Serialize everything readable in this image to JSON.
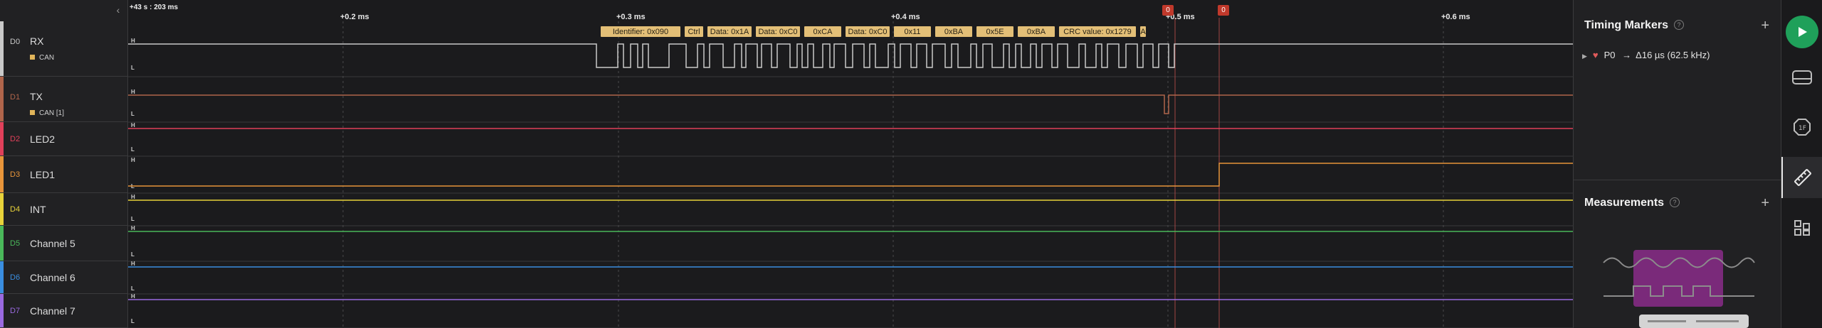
{
  "timeline": {
    "origin_label": "+43 s : 203 ms",
    "ticks": [
      "+0.2 ms",
      "+0.3 ms",
      "+0.4 ms",
      "+0.5 ms",
      "+0.6 ms"
    ]
  },
  "markers": {
    "flag_a": "0",
    "flag_b": "0"
  },
  "channels": [
    {
      "id": "D0",
      "name": "RX",
      "tag": "CAN",
      "color": "#c9c9c9"
    },
    {
      "id": "D1",
      "name": "TX",
      "tag": "CAN [1]",
      "color": "#b0654b"
    },
    {
      "id": "D2",
      "name": "LED2",
      "tag": "",
      "color": "#e0405a"
    },
    {
      "id": "D3",
      "name": "LED1",
      "tag": "",
      "color": "#e8953a"
    },
    {
      "id": "D4",
      "name": "INT",
      "tag": "",
      "color": "#e8d23a"
    },
    {
      "id": "D5",
      "name": "Channel 5",
      "tag": "",
      "color": "#4ab85a"
    },
    {
      "id": "D6",
      "name": "Channel 6",
      "tag": "",
      "color": "#3a8ee0"
    },
    {
      "id": "D7",
      "name": "Channel 7",
      "tag": "",
      "color": "#9a6ae0"
    }
  ],
  "level_labels": {
    "high": "H",
    "low": "L"
  },
  "can_frames": [
    "Identifier: 0x090",
    "Ctrl",
    "Data: 0x1A",
    "Data: 0xC0",
    "0xCA",
    "Data: 0xC0",
    "0x11",
    "0xBA",
    "0x5E",
    "0xBA",
    "CRC value: 0x1279",
    "A"
  ],
  "timing_markers": {
    "title": "Timing Markers",
    "help": "?",
    "add": "+",
    "entry": {
      "name": "P0",
      "arrow": "→",
      "value": "Δ16 µs (62.5 kHz)"
    }
  },
  "measurements": {
    "title": "Measurements",
    "help": "?",
    "add": "+"
  },
  "toolbar": {
    "icons": [
      "play-icon",
      "analyzers-icon",
      "extensions-icon",
      "timing-ruler-icon",
      "layout-icon"
    ]
  }
}
